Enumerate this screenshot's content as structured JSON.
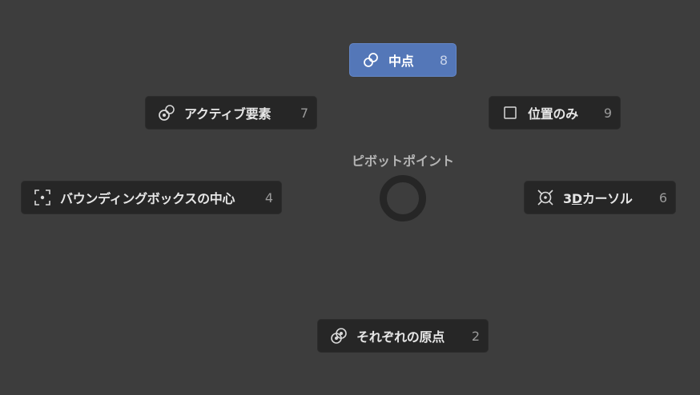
{
  "pie_menu": {
    "title": "ピボットポイント",
    "items": {
      "median": {
        "label": "中点",
        "key": "8",
        "icon": "median-point-icon",
        "active": true
      },
      "active_element": {
        "label": "アクティブ要素",
        "key": "7",
        "icon": "active-element-icon"
      },
      "individual_origins": {
        "label": "それぞれの原点",
        "key": "2",
        "icon": "individual-origins-icon"
      },
      "bounding_box": {
        "label": "バウンディングボックスの中心",
        "key": "4",
        "icon": "bounding-box-center-icon"
      },
      "location_only": {
        "label": "位置のみ",
        "key": "9",
        "icon": "checkbox-icon"
      },
      "cursor_3d": {
        "label_prefix": "3",
        "label_underlined": "D",
        "label_suffix": "カーソル",
        "key": "6",
        "icon": "3d-cursor-icon"
      }
    }
  },
  "colors": {
    "background": "#3d3d3d",
    "item_bg": "#262626",
    "active_bg": "#5477b8",
    "text": "#e6e6e6",
    "key_text": "#9a9a9a"
  }
}
